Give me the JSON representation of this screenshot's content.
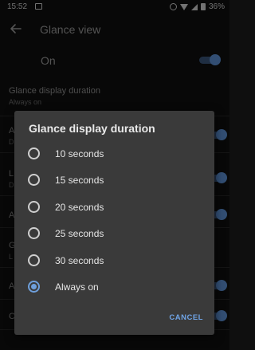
{
  "status_bar": {
    "time": "15:52",
    "battery": "36%"
  },
  "toolbar": {
    "title": "Glance view"
  },
  "master": {
    "label": "On",
    "enabled": true
  },
  "settings": [
    {
      "title": "Glance display duration",
      "summary": "Always on"
    },
    {
      "title": "A",
      "summary": "D"
    },
    {
      "title": "L",
      "summary": "D"
    },
    {
      "title": "A",
      "summary": ""
    },
    {
      "title": "G",
      "summary": "L"
    },
    {
      "title": "A",
      "summary": ""
    },
    {
      "title": "C",
      "summary": ""
    }
  ],
  "dialog": {
    "title": "Glance display duration",
    "options": [
      {
        "label": "10 seconds",
        "checked": false
      },
      {
        "label": "15 seconds",
        "checked": false
      },
      {
        "label": "20 seconds",
        "checked": false
      },
      {
        "label": "25 seconds",
        "checked": false
      },
      {
        "label": "30 seconds",
        "checked": false
      },
      {
        "label": "Always on",
        "checked": true
      }
    ],
    "cancel_label": "CANCEL"
  },
  "colors": {
    "accent": "#6e9fdb",
    "dialog_bg": "#3a3a3a",
    "background": "#0f0f0f"
  }
}
